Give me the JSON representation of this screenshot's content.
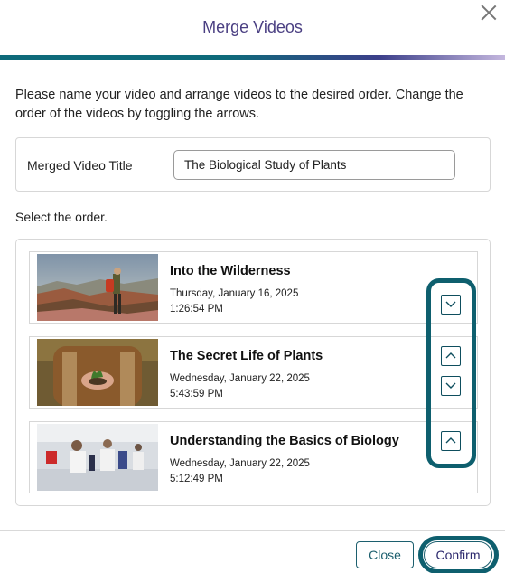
{
  "modal": {
    "title": "Merge Videos",
    "instructions": "Please name your video and arrange videos to the desired order. Change the order of the videos by toggling the arrows.",
    "title_field_label": "Merged Video Title",
    "title_field_value": "The Biological Study of Plants",
    "select_label": "Select the order."
  },
  "videos": [
    {
      "title": "Into the Wilderness",
      "date": "Thursday, January 16, 2025",
      "time": "1:26:54 PM",
      "arrows": [
        "down"
      ]
    },
    {
      "title": "The Secret Life of Plants",
      "date": "Wednesday, January 22, 2025",
      "time": "5:43:59 PM",
      "arrows": [
        "up",
        "down"
      ]
    },
    {
      "title": "Understanding the Basics of Biology",
      "date": "Wednesday, January 22, 2025",
      "time": "5:12:49 PM",
      "arrows": [
        "up"
      ]
    }
  ],
  "footer": {
    "close_label": "Close",
    "confirm_label": "Confirm"
  },
  "colors": {
    "title": "#4a3f82",
    "accent": "#0e5f6e",
    "button_text": "#1c5f6e"
  }
}
